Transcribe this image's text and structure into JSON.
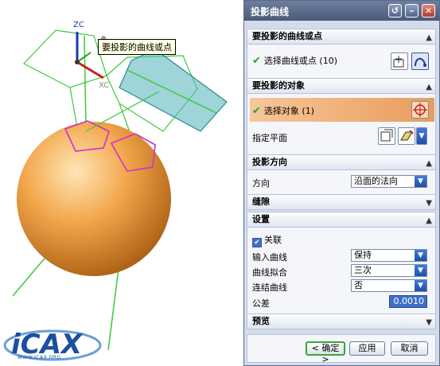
{
  "viewport": {
    "tooltip": "要投影的曲线或点",
    "axis_zc": "ZC",
    "axis_xc": "XC",
    "logo_text": "iCAX",
    "logo_subtext": "WWW.ICAX.ORG"
  },
  "dialog": {
    "title": "投影曲线",
    "titlebar_icons": [
      "reset-icon",
      "minimize-icon",
      "close-icon"
    ],
    "sections": {
      "curves": {
        "header": "要投影的曲线或点",
        "select_label": "选择曲线或点 (10)"
      },
      "objects": {
        "header": "要投影的对象",
        "select_label": "选择对象 (1)",
        "plane_label": "指定平面"
      },
      "direction": {
        "header": "投影方向",
        "label": "方向",
        "value": "沿面的法向"
      },
      "gap": {
        "header": "缝隙"
      },
      "settings": {
        "header": "设置",
        "associative_label": "关联",
        "associative_checked": true,
        "input_curve_label": "输入曲线",
        "input_curve_value": "保持",
        "curve_fit_label": "曲线拟合",
        "curve_fit_value": "三次",
        "join_curve_label": "连结曲线",
        "join_curve_value": "否",
        "tolerance_label": "公差",
        "tolerance_value": "0.0010"
      },
      "preview": {
        "header": "预览"
      }
    },
    "buttons": {
      "ok": "< 确定 >",
      "apply": "应用",
      "cancel": "取消"
    }
  },
  "colors": {
    "sphere": "#f0a040",
    "wire_green": "#3cc83c",
    "curve_magenta": "#d030d0",
    "plane_teal": "#5fb8c0",
    "highlight_orange": "#e99c5b",
    "titlebar": "#55658a",
    "field_blue": "#3f6fc8"
  }
}
